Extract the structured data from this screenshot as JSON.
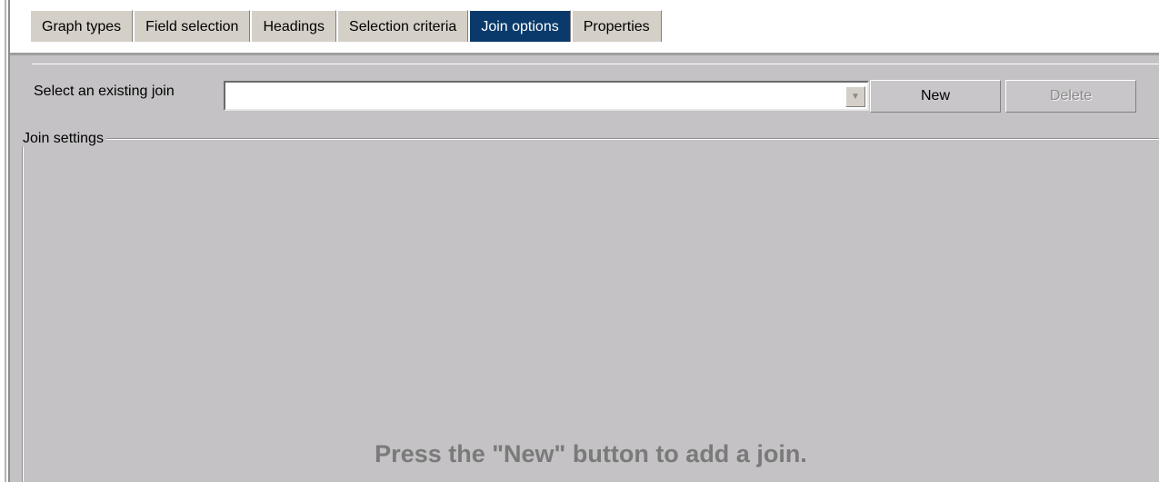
{
  "tabs": [
    {
      "label": "Graph types",
      "active": false
    },
    {
      "label": "Field selection",
      "active": false
    },
    {
      "label": "Headings",
      "active": false
    },
    {
      "label": "Selection criteria",
      "active": false
    },
    {
      "label": "Join options",
      "active": true
    },
    {
      "label": "Properties",
      "active": false
    }
  ],
  "join": {
    "select_label": "Select an existing join",
    "select_value": "",
    "new_label": "New",
    "delete_label": "Delete",
    "delete_enabled": false,
    "settings_title": "Join settings",
    "hint": "Press the \"New\" button to add a join."
  },
  "colors": {
    "active_tab": "#0a3a6b",
    "panel": "#c4c2c4",
    "hint_text": "#7a7a7a"
  },
  "icons": {
    "combo_arrow": "chevron-down-icon"
  }
}
